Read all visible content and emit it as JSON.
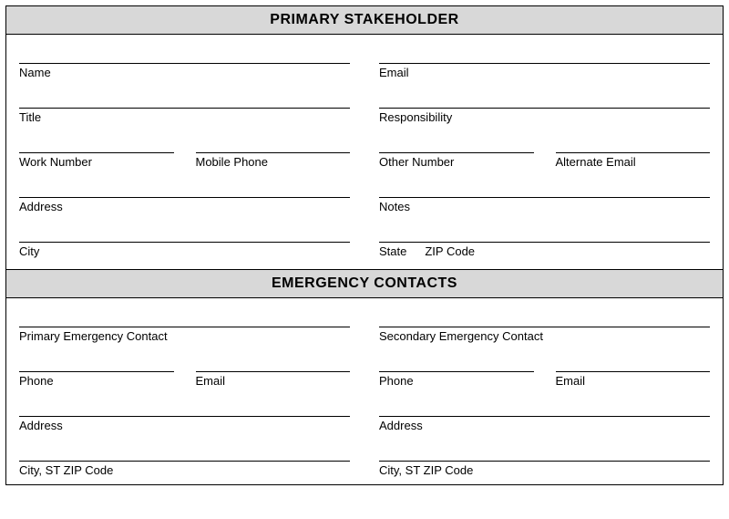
{
  "primary": {
    "title": "PRIMARY STAKEHOLDER",
    "fields": {
      "name": "Name",
      "email": "Email",
      "title": "Title",
      "responsibility": "Responsibility",
      "work_number": "Work Number",
      "mobile_phone": "Mobile Phone",
      "other_number": "Other Number",
      "alternate_email": "Alternate Email",
      "address": "Address",
      "notes": "Notes",
      "city": "City",
      "state": "State",
      "zip": "ZIP Code"
    }
  },
  "emergency": {
    "title": "EMERGENCY CONTACTS",
    "fields": {
      "primary_contact": "Primary Emergency Contact",
      "secondary_contact": "Secondary Emergency Contact",
      "phone": "Phone",
      "email": "Email",
      "address": "Address",
      "city_st_zip": "City, ST  ZIP Code"
    }
  }
}
